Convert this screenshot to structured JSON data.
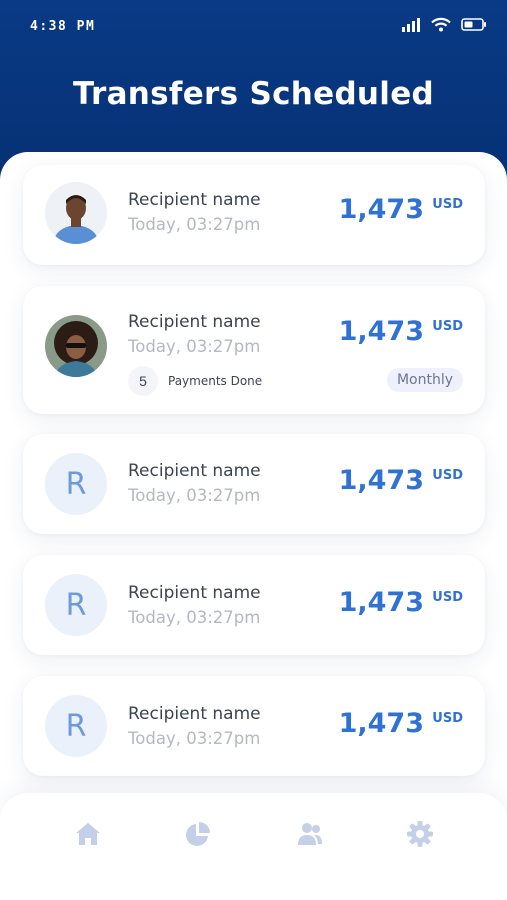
{
  "status_bar": {
    "time": "4:38 PM",
    "icons": [
      "signal-icon",
      "wifi-icon",
      "battery-icon"
    ]
  },
  "header": {
    "title": "Transfers Scheduled"
  },
  "colors": {
    "header_bg": "#06357a",
    "accent": "#2f72d3",
    "avatar_bg": "#eaf1fb"
  },
  "transfers": [
    {
      "avatar": "photo",
      "name": "Recipient name",
      "time": "Today, 03:27pm",
      "amount": "1,473",
      "currency": "USD"
    },
    {
      "avatar": "photo",
      "name": "Recipient name",
      "time": "Today, 03:27pm",
      "amount": "1,473",
      "currency": "USD",
      "payments_count": "5",
      "payments_label": "Payments Done",
      "frequency": "Monthly"
    },
    {
      "avatar": "R",
      "name": "Recipient name",
      "time": "Today, 03:27pm",
      "amount": "1,473",
      "currency": "USD"
    },
    {
      "avatar": "R",
      "name": "Recipient name",
      "time": "Today, 03:27pm",
      "amount": "1,473",
      "currency": "USD"
    },
    {
      "avatar": "R",
      "name": "Recipient name",
      "time": "Today, 03:27pm",
      "amount": "1,473",
      "currency": "USD"
    }
  ],
  "bottom_nav": {
    "items": [
      "home-icon",
      "pie-chart-icon",
      "users-icon",
      "settings-icon"
    ]
  }
}
